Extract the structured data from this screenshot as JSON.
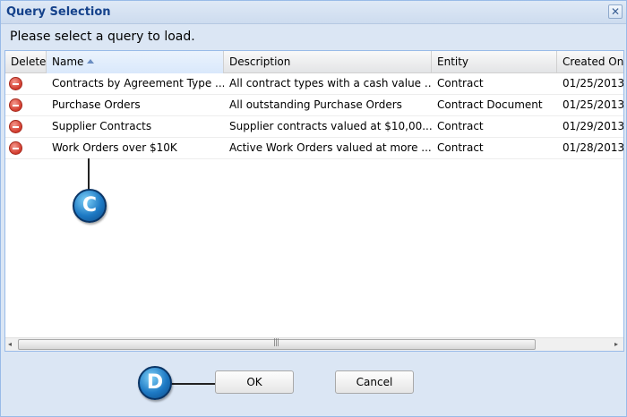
{
  "dialog": {
    "title": "Query Selection",
    "close_glyph": "✕",
    "prompt": "Please select a query to load."
  },
  "grid": {
    "columns": [
      "Delete",
      "Name",
      "Description",
      "Entity",
      "Created On"
    ],
    "sorted_column": "Name",
    "sort_direction": "ascending",
    "rows": [
      {
        "name": "Contracts by Agreement Type ...",
        "description": "All contract types with a cash value ...",
        "entity": "Contract",
        "created": "01/25/2013"
      },
      {
        "name": "Purchase Orders",
        "description": "All outstanding Purchase Orders",
        "entity": "Contract Document",
        "created": "01/25/2013"
      },
      {
        "name": "Supplier Contracts",
        "description": "Supplier contracts valued at $10,00...",
        "entity": "Contract",
        "created": "01/29/2013"
      },
      {
        "name": "Work Orders over $10K",
        "description": "Active Work Orders valued at more ...",
        "entity": "Contract",
        "created": "01/28/2013"
      }
    ],
    "scroll": {
      "left_arrow": "◂",
      "right_arrow": "▸",
      "grip": "|||"
    }
  },
  "callouts": {
    "c": "C",
    "d": "D"
  },
  "buttons": {
    "ok": "OK",
    "cancel": "Cancel"
  },
  "colors": {
    "title": "#15428b",
    "frame": "#dbe6f4",
    "border": "#99bbe8",
    "delete_icon": "#d23a2c",
    "callout": "#1d79c4"
  }
}
